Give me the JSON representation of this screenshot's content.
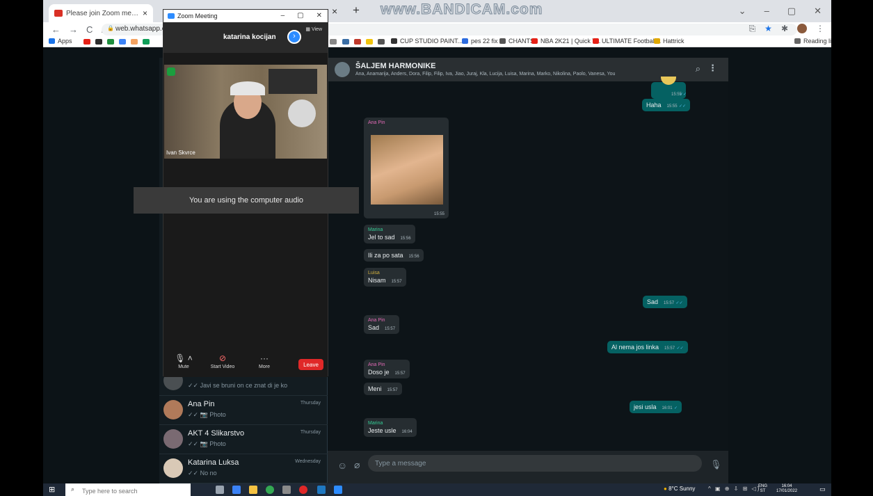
{
  "browser": {
    "tabs": [
      {
        "title": "Please join Zoom meeting in pro",
        "icon": "gmail-icon"
      }
    ],
    "watermark": "www.BANDICAM.com",
    "url": "web.whatsapp.co",
    "bookmarks": [
      "Apps",
      "CUP STUDIO PAINT...",
      "pes 22 fix",
      "CHANTS",
      "NBA 2K21 | Quick T...",
      "ULTIMATE Football...",
      "Hattrick",
      "Reading list"
    ]
  },
  "zoom": {
    "window_title": "Zoom Meeting",
    "participant_name": "katarina kocijan",
    "view_label": "View",
    "video_label": "Ivan Skvrce",
    "audio_toast": "You are using the computer audio",
    "controls": {
      "mute": "Mute",
      "start_video": "Start Video",
      "more": "More",
      "leave": "Leave"
    }
  },
  "whatsapp": {
    "group": {
      "name": "ŠALJEM HARMONIKE",
      "members": "Ana, Anamarija, Anders, Dora, Filip, Filip, Iva, Jiao, Juraj, Kla, Lucija, Luisa, Marina, Marko, Nikolina, Paolo, Vanesa, You"
    },
    "chats": [
      {
        "name": "",
        "preview": "✓✓ Javi se bruni on ce znat di je ko",
        "time": ""
      },
      {
        "name": "Ana Pin",
        "preview": "✓✓ 📷 Photo",
        "time": "Thursday"
      },
      {
        "name": "AKT 4 Slikarstvo",
        "preview": "✓✓ 📷 Photo",
        "time": "Thursday"
      },
      {
        "name": "Katarina Luksa",
        "preview": "✓✓ No no",
        "time": "Wednesday"
      }
    ],
    "messages": [
      {
        "dir": "out",
        "text": "",
        "time": "15:55"
      },
      {
        "dir": "out",
        "text": "Haha",
        "time": "15:55"
      },
      {
        "dir": "in",
        "sender": "Ana Pin",
        "text": "",
        "time": "15:55",
        "photo": true
      },
      {
        "dir": "in",
        "sender": "Marina",
        "text": "Jel to sad",
        "time": "15:56"
      },
      {
        "dir": "in",
        "text": "Ili za po sata",
        "time": "15:56"
      },
      {
        "dir": "in",
        "sender": "Luisa",
        "text": "Nisam",
        "time": "15:57"
      },
      {
        "dir": "out",
        "text": "Sad",
        "time": "15:57"
      },
      {
        "dir": "in",
        "sender": "Ana Pin",
        "text": "Sad",
        "time": "15:57"
      },
      {
        "dir": "out",
        "text": "Al nema jos linka",
        "time": "15:57"
      },
      {
        "dir": "in",
        "sender": "Ana Pin",
        "text": "Doso je",
        "time": "15:57"
      },
      {
        "dir": "in",
        "text": "Meni",
        "time": "15:57"
      },
      {
        "dir": "out",
        "text": "jesi usla",
        "time": "16:01"
      },
      {
        "dir": "in",
        "sender": "Marina",
        "text": "Jeste usle",
        "time": "16:04"
      }
    ],
    "input_placeholder": "Type a message",
    "sender_colors": {
      "Ana Pin": "#e26ab6",
      "Marina": "#35cd96",
      "Luisa": "#d3b13f"
    }
  },
  "taskbar": {
    "search_placeholder": "Type here to search",
    "weather": "8°C  Sunny",
    "lang": [
      "ENG",
      "ST"
    ],
    "time": "16:04",
    "date": "17/01/2022"
  }
}
